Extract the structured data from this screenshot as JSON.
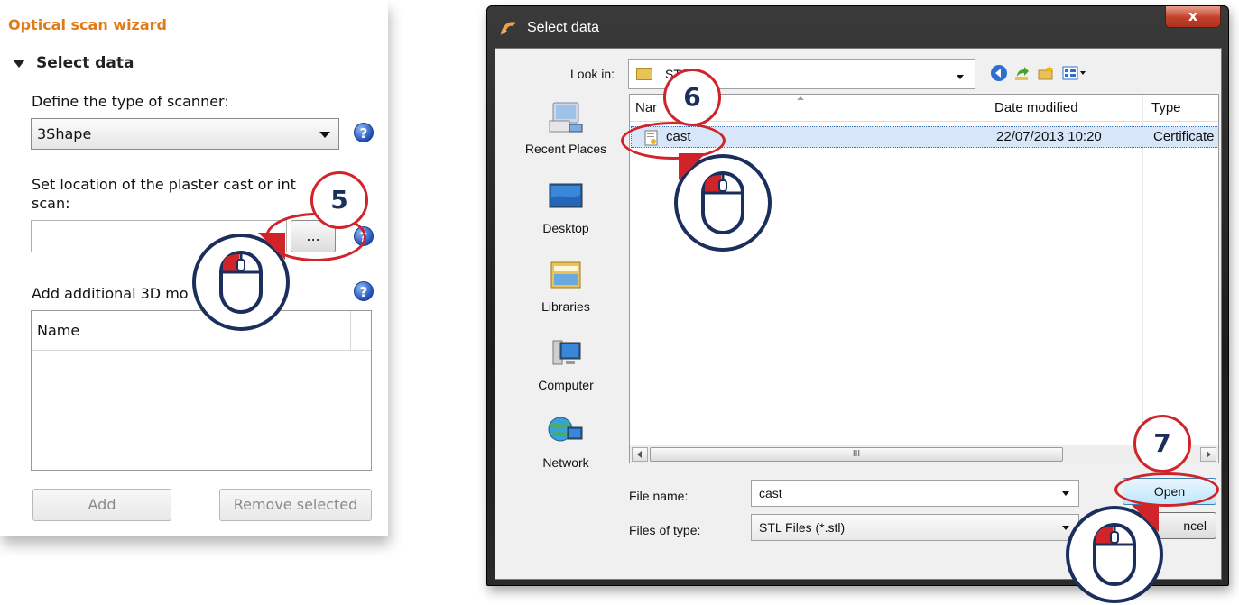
{
  "wizard": {
    "title": "Optical scan wizard",
    "section": "Select data",
    "scanner_label": "Define the type of scanner:",
    "scanner_value": "3Shape",
    "location_label_line1": "Set location of the plaster cast or int",
    "location_label_line2": "scan:",
    "location_value": "",
    "browse_label": "...",
    "additional_label": "Add additional 3D mo",
    "list_header": "Name",
    "add_label": "Add",
    "remove_label": "Remove selected",
    "help_glyph": "?"
  },
  "dialog": {
    "title": "Select data",
    "close_label": "x",
    "look_in_label": "Look in:",
    "look_in_value": "ST",
    "places": [
      {
        "label": "Recent Places",
        "icon": "recent-places-icon"
      },
      {
        "label": "Desktop",
        "icon": "desktop-icon"
      },
      {
        "label": "Libraries",
        "icon": "libraries-icon"
      },
      {
        "label": "Computer",
        "icon": "computer-icon"
      },
      {
        "label": "Network",
        "icon": "network-icon"
      }
    ],
    "columns": [
      "Nar",
      "Date modified",
      "Type"
    ],
    "files": [
      {
        "name": "cast",
        "date": "22/07/2013 10:20",
        "type": "Certificate"
      }
    ],
    "scroll_grip": "III",
    "file_name_label": "File name:",
    "file_name_value": "cast",
    "file_type_label": "Files of type:",
    "file_type_value": "STL Files (*.stl)",
    "open_label": "Open",
    "cancel_label": "ncel"
  },
  "annotations": {
    "step5": "5",
    "step6": "6",
    "step7": "7",
    "accent": "#d0242a",
    "navy": "#1b2f5c"
  }
}
